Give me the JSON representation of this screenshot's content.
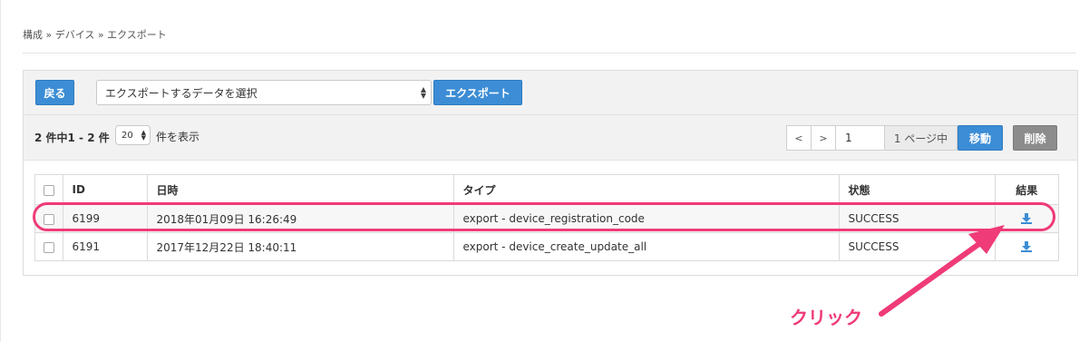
{
  "breadcrumb": "構成 » デバイス » エクスポート",
  "toolbar": {
    "back_label": "戻る",
    "select_value": "エクスポートするデータを選択",
    "export_label": "エクスポート"
  },
  "listbar": {
    "count_text": "2 件中1 - 2 件",
    "per_page": "20",
    "show_label": "件を表示",
    "prev": "<",
    "next": ">",
    "page_value": "1",
    "page_of": "1 ページ中",
    "move_label": "移動",
    "delete_label": "削除"
  },
  "table": {
    "headers": {
      "id": "ID",
      "datetime": "日時",
      "type": "タイプ",
      "status": "状態",
      "result": "結果"
    },
    "rows": [
      {
        "id": "6199",
        "datetime": "2018年01月09日 16:26:49",
        "type": "export - device_registration_code",
        "status": "SUCCESS",
        "result_icon": "download-icon"
      },
      {
        "id": "6191",
        "datetime": "2017年12月22日 18:40:11",
        "type": "export - device_create_update_all",
        "status": "SUCCESS",
        "result_icon": "download-icon"
      }
    ]
  },
  "annotation": {
    "callout": "クリック",
    "color": "#ef3b78"
  },
  "colors": {
    "primary": "#3c8dd5",
    "danger_gray": "#8c8c8c"
  }
}
